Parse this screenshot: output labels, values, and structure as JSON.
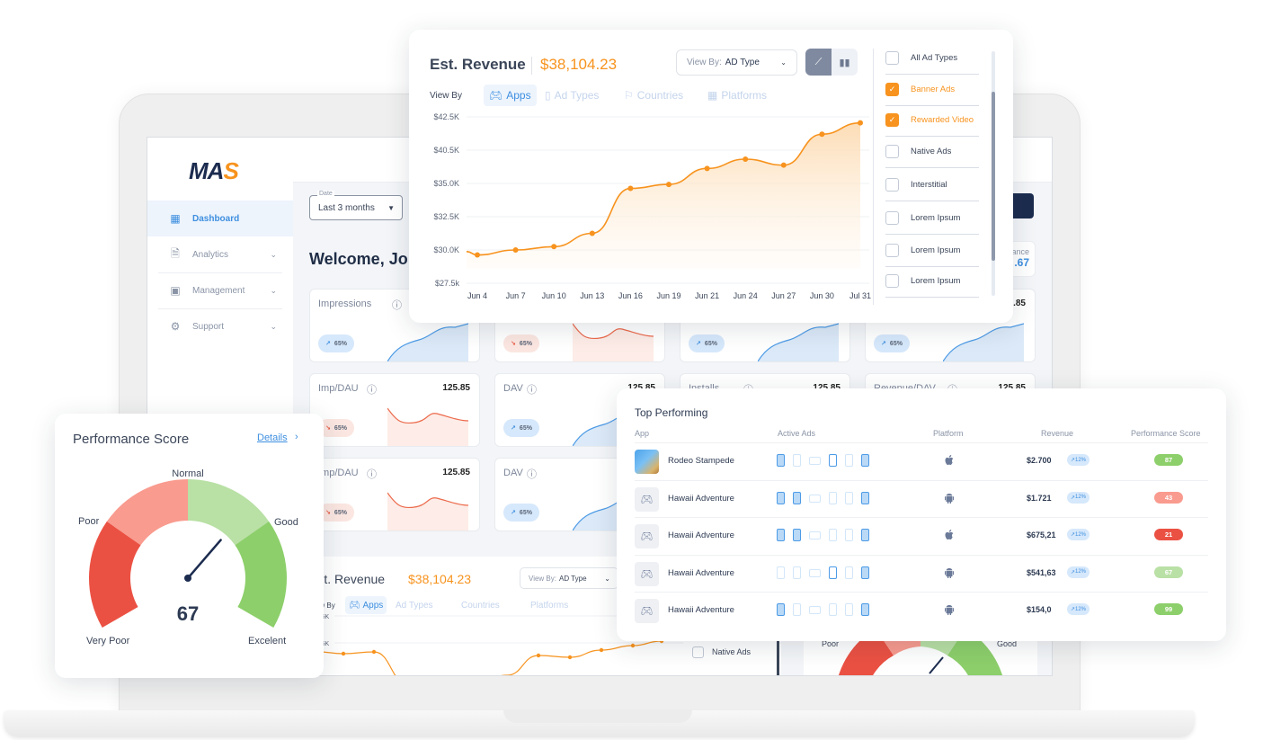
{
  "app": {
    "logo": "MAS"
  },
  "sidebar": {
    "items": [
      {
        "label": "Dashboard",
        "icon": "dashboard-grid-icon",
        "active": true
      },
      {
        "label": "Analytics",
        "icon": "analytics-report-icon",
        "expandable": true
      },
      {
        "label": "Management",
        "icon": "management-grid-icon",
        "expandable": true
      },
      {
        "label": "Support",
        "icon": "support-gear-icon",
        "expandable": true
      }
    ]
  },
  "topbar": {
    "date_label": "Date",
    "date_value": "Last 3 months",
    "user_menu_fragment": "nt"
  },
  "main": {
    "welcome": "Welcome, Joh",
    "balance_label_fragment": "ance",
    "balance_value_fragment": ".67",
    "metric_cards": [
      {
        "title": "Impressions",
        "value": "",
        "change": "65%",
        "trend": "up"
      },
      {
        "title": "",
        "value": "",
        "change": "65%",
        "trend": "down"
      },
      {
        "title": "",
        "value": "",
        "change": "65%",
        "trend": "up"
      },
      {
        "title": "",
        "value": "5.85",
        "change": "65%",
        "trend": "up"
      },
      {
        "title": "Imp/DAU",
        "value": "125.85",
        "change": "65%",
        "trend": "down"
      },
      {
        "title": "DAV",
        "value": "125.85",
        "change": "65%",
        "trend": "up"
      },
      {
        "title": "Installs",
        "value": "125.85",
        "change": "",
        "trend": "up"
      },
      {
        "title": "Revenue/DAV",
        "value": "125.85",
        "change": "",
        "trend": "up"
      },
      {
        "title": "Imp/DAU",
        "value": "125.85",
        "change": "65%",
        "trend": "down"
      },
      {
        "title": "DAV",
        "value": "",
        "change": "65%",
        "trend": "up"
      }
    ],
    "bg_revenue": {
      "title": "Est. Revenue",
      "value": "$38,104.23",
      "view_by_key": "View By:",
      "view_by_value": "AD Type",
      "view_by_label": "View By",
      "tabs": [
        "Apps",
        "Ad Types",
        "Countries",
        "Platforms"
      ],
      "y_ticks": [
        "$42.5K",
        "$40.5K"
      ],
      "visible_option": "Native Ads"
    },
    "bg_gauge": {
      "labels": [
        "Poor",
        "Good"
      ]
    }
  },
  "revenue_card": {
    "title": "Est. Revenue",
    "value": "$38,104.23",
    "view_by_key": "View By:",
    "view_by_value": "AD Type",
    "chart_toggle": [
      "line-chart-icon",
      "bar-chart-icon"
    ],
    "view_by_label": "View By",
    "tabs": [
      {
        "label": "Apps",
        "icon": "gamepad-icon",
        "active": true
      },
      {
        "label": "Ad Types",
        "icon": "phone-icon",
        "active": false
      },
      {
        "label": "Countries",
        "icon": "flag-icon",
        "active": false
      },
      {
        "label": "Platforms",
        "icon": "grid-icon",
        "active": false
      }
    ],
    "ad_types": [
      {
        "label": "All Ad Types",
        "checked": false
      },
      {
        "label": "Banner Ads",
        "checked": true
      },
      {
        "label": "Rewarded Video",
        "checked": true
      },
      {
        "label": "Native Ads",
        "checked": false
      },
      {
        "label": "Interstitial",
        "checked": false
      },
      {
        "label": "Lorem Ipsum",
        "checked": false
      },
      {
        "label": "Lorem Ipsum",
        "checked": false
      },
      {
        "label": "Lorem Ipsum",
        "checked": false
      }
    ]
  },
  "chart_data": {
    "type": "area",
    "title": "Est. Revenue",
    "xlabel": "",
    "ylabel": "",
    "y_tick_labels": [
      "$27.5k",
      "$30.0K",
      "$32.5K",
      "$35.0K",
      "$40.5K",
      "$42.5K"
    ],
    "x": [
      "Jun 4",
      "Jun 7",
      "Jun 10",
      "Jun 13",
      "Jun 16",
      "Jun 19",
      "Jun 21",
      "Jun 24",
      "Jun 27",
      "Jun 30",
      "Jul 31"
    ],
    "series": [
      {
        "name": "Est. Revenue",
        "color": "#f7931e",
        "tick_index_values": [
          0.85,
          1.0,
          1.1,
          1.5,
          2.85,
          2.97,
          3.45,
          3.73,
          3.55,
          4.48,
          4.82
        ]
      }
    ],
    "note": "tick_index_values are positions on the y-tick label scale (0 = $27.5k, 5 = $42.5K)",
    "grid": true,
    "legend": "none"
  },
  "performance_score": {
    "title": "Performance Score",
    "details_link": "Details",
    "score": 67,
    "max": 100,
    "segments": [
      {
        "label": "Very Poor",
        "color": "#eb5143"
      },
      {
        "label": "Poor",
        "color": "#f99b8f"
      },
      {
        "label": "Normal",
        "color": "#b9e0a5"
      },
      {
        "label": "Good",
        "color": "#8dcf6b"
      }
    ],
    "labels": {
      "very_poor": "Very Poor",
      "poor": "Poor",
      "normal": "Normal",
      "good": "Good",
      "excellent": "Excelent"
    }
  },
  "top_performing": {
    "title": "Top Performing",
    "columns": [
      "App",
      "Active Ads",
      "Platform",
      "Revenue",
      "Performance Score"
    ],
    "rows": [
      {
        "app": "Rodeo Stampede",
        "thumb": "image",
        "ads_active": [
          1,
          0,
          0,
          1,
          0,
          1
        ],
        "ads_fill": [
          1,
          0,
          0,
          0,
          0,
          1
        ],
        "platform": "ios",
        "revenue": "$2.700",
        "change": "12%",
        "score": "87",
        "score_color": "#8dcf6b"
      },
      {
        "app": "Hawaii Adventure",
        "thumb": "gamepad",
        "ads_active": [
          1,
          1,
          0,
          0,
          0,
          1
        ],
        "ads_fill": [
          1,
          1,
          0,
          0,
          0,
          1
        ],
        "platform": "android",
        "revenue": "$1.721",
        "change": "12%",
        "score": "43",
        "score_color": "#f99b8f"
      },
      {
        "app": "Hawaii Adventure",
        "thumb": "gamepad",
        "ads_active": [
          1,
          1,
          0,
          0,
          0,
          1
        ],
        "ads_fill": [
          1,
          1,
          0,
          0,
          0,
          1
        ],
        "platform": "ios",
        "revenue": "$675,21",
        "change": "12%",
        "score": "21",
        "score_color": "#eb5143"
      },
      {
        "app": "Hawaii Adventure",
        "thumb": "gamepad",
        "ads_active": [
          0,
          0,
          0,
          1,
          0,
          1
        ],
        "ads_fill": [
          0,
          0,
          0,
          0,
          0,
          1
        ],
        "platform": "android",
        "revenue": "$541,63",
        "change": "12%",
        "score": "67",
        "score_color": "#b9e0a5"
      },
      {
        "app": "Hawaii Adventure",
        "thumb": "gamepad",
        "ads_active": [
          1,
          0,
          0,
          0,
          0,
          1
        ],
        "ads_fill": [
          1,
          0,
          0,
          0,
          0,
          1
        ],
        "platform": "android",
        "revenue": "$154,0",
        "change": "12%",
        "score": "99",
        "score_color": "#8dcf6b"
      }
    ]
  },
  "colors": {
    "accent": "#f7931e",
    "primary": "#3e8fe0",
    "navy": "#1c2c4f"
  }
}
